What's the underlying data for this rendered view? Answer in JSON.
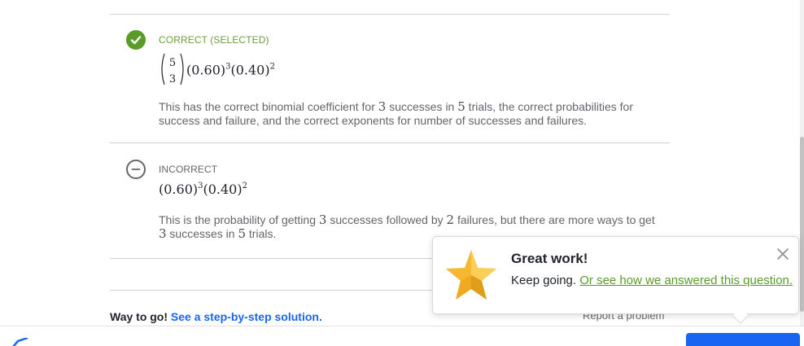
{
  "choices": [
    {
      "status": "CORRECT (SELECTED)",
      "binom_top": "5",
      "binom_bottom": "3",
      "expr_a": "(0.60)",
      "exp_a": "3",
      "expr_b": "(0.40)",
      "exp_b": "2",
      "explanation": {
        "p1": "This has the correct binomial coefficient for ",
        "n1": "3",
        "p2": " successes in ",
        "n2": "5",
        "p3": " trials, the correct probabilities for success and failure, and the correct exponents for number of successes and failures."
      }
    },
    {
      "status": "INCORRECT",
      "expr_a": "(0.60)",
      "exp_a": "3",
      "expr_b": "(0.40)",
      "exp_b": "2",
      "explanation": {
        "p1": "This is the probability of getting ",
        "n1": "3",
        "p2": " successes followed by ",
        "n2": "2",
        "p3": " failures, but there are more ways to get ",
        "n3": "3",
        "p4": " successes in ",
        "n4": "5",
        "p5": " trials."
      }
    }
  ],
  "footer": {
    "way_to_go": "Way to go!",
    "solution_link": "See a step-by-step solution.",
    "report": "Report a problem"
  },
  "toast": {
    "title": "Great work!",
    "body": "Keep going.",
    "link": "Or see how we answered this question."
  },
  "colors": {
    "correct": "#5a9b2a",
    "link_blue": "#1865f2",
    "star": "#f5b82e"
  },
  "icons": {
    "correct": "checkmark-icon",
    "incorrect": "minus-icon",
    "close": "close-icon",
    "star": "star-icon"
  }
}
